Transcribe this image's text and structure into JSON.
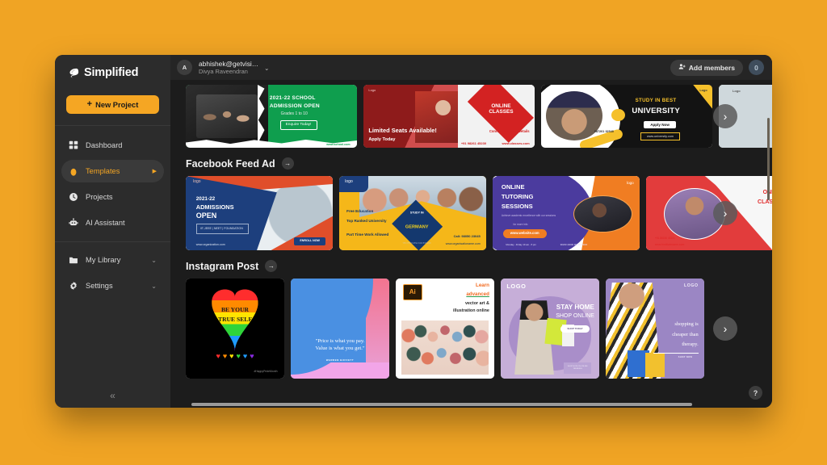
{
  "app": {
    "brand": "Simplified",
    "background_color": "#F0A424",
    "accent_color": "#F5A623",
    "window_bg": "#1c1c1c",
    "sidebar_bg": "#2c2c2c"
  },
  "sidebar": {
    "new_project_label": "New Project",
    "collapse_label": "«",
    "items": [
      {
        "label": "Dashboard",
        "icon": "grid-icon",
        "active": false,
        "caret": ""
      },
      {
        "label": "Templates",
        "icon": "templates-icon",
        "active": true,
        "caret": "right"
      },
      {
        "label": "Projects",
        "icon": "clock-icon",
        "active": false,
        "caret": ""
      },
      {
        "label": "AI Assistant",
        "icon": "robot-icon",
        "active": false,
        "caret": ""
      },
      {
        "label": "My Library",
        "icon": "folder-icon",
        "active": false,
        "caret": "down"
      },
      {
        "label": "Settings",
        "icon": "gear-icon",
        "active": false,
        "caret": "down"
      }
    ]
  },
  "topbar": {
    "avatar_initial": "A",
    "email": "abhishek@getvisi…",
    "name": "Divya Raveendran",
    "dropdown_icon": "chevron-down-icon",
    "add_members_label": "Add members",
    "add_members_icon": "add-user-icon",
    "member_count": "0"
  },
  "sections": [
    {
      "id": "banner-row",
      "title": "",
      "arrow_label": "→",
      "cards": [
        {
          "name": "school-admission-open-banner",
          "kind": "banner-green",
          "texts": {
            "line1": "2021-22 SCHOOL",
            "line2": "ADMISSION OPEN",
            "line3": "Grades 1 to 10",
            "cta": "Enquire Today!",
            "footer": "www.school.com"
          }
        },
        {
          "name": "online-classes-banner",
          "kind": "banner-red",
          "texts": {
            "logo": "Logo",
            "badge1": "ONLINE",
            "badge2": "CLASSES",
            "line1": "Limited Seats Available!",
            "line2": "Apply Today",
            "cta": "Connect for more Details",
            "phone": "+91 98261 45230",
            "url": "www.classes.com"
          }
        },
        {
          "name": "study-in-best-university-banner",
          "kind": "banner-dark",
          "texts": {
            "logo": "Logo",
            "line1": "STUDY IN BEST",
            "line2": "UNIVERSITY",
            "cta": "Apply Now",
            "url": "www.university.com",
            "phone": "987201 32540"
          }
        },
        {
          "name": "partial-banner",
          "kind": "banner-partial",
          "texts": {
            "logo": "Logo"
          }
        }
      ],
      "next_label": "›"
    },
    {
      "id": "facebook-feed-ad",
      "title": "Facebook Feed Ad",
      "arrow_label": "→",
      "cards": [
        {
          "name": "admissions-open-card",
          "kind": "fb-navy",
          "texts": {
            "logo": "logo",
            "line1": "2021-22",
            "line2": "ADMISSIONS",
            "line3": "OPEN",
            "tag": "IIT-JEEE | NEET | FOUNDATION",
            "url": "www.organization.com",
            "cta": "ENROLL NOW"
          }
        },
        {
          "name": "study-in-germany-card",
          "kind": "fb-yellow",
          "texts": {
            "logo": "logo",
            "b1": "Free Education",
            "b2": "Top Ranked University",
            "b3": "Part Time Work Allowed",
            "badge1": "STUDY IN",
            "badge2": "GERMANY",
            "badge3": "One of the leading study destination",
            "phone": "Call: 98050 23045",
            "url": "www.organisationame.com"
          }
        },
        {
          "name": "online-tutoring-sessions-card",
          "kind": "fb-purple",
          "texts": {
            "logo": "logo",
            "line1": "ONLINE",
            "line2": "TUTORING",
            "line3": "SESSIONS",
            "sub": "Achieve academic excellence with our sessions",
            "more": "for more info",
            "url": "www.website.com",
            "hours": "Monday - Friday 10 am - 5 pm",
            "phone": "90230 44000 90230 44000"
          }
        },
        {
          "name": "online-classes-partial-card",
          "kind": "fb-red",
          "texts": {
            "line1": "ONLINE",
            "line2": "CLASSES",
            "phone": "+91 86230 45101",
            "url": "www.institutename.com"
          }
        }
      ],
      "next_label": "›"
    },
    {
      "id": "instagram-post",
      "title": "Instagram Post",
      "arrow_label": "→",
      "cards": [
        {
          "name": "be-your-true-self-post",
          "kind": "ig-pride",
          "texts": {
            "line1": "BE YOUR",
            "line2": "TRUE SELF",
            "hashtag": "#HappyPrideMonth"
          }
        },
        {
          "name": "buffett-quote-post",
          "kind": "ig-quote",
          "texts": {
            "line1": "\"Price is what you pay.",
            "line2": "Value is what you get.\"",
            "author": "WARREN BUFFETT"
          }
        },
        {
          "name": "learn-vector-art-post",
          "kind": "ig-illustrator",
          "texts": {
            "badge": "Ai",
            "line1": "Learn",
            "line2": "advanced",
            "line3": "vector art &",
            "line4": "illustration online"
          }
        },
        {
          "name": "stay-home-shop-online-post",
          "kind": "ig-shop",
          "texts": {
            "logo": "LOGO",
            "line1": "STAY HOME",
            "line2": "SHOP ONLINE",
            "cta": "SHOP TODAY",
            "tag": "SHOP NOW ON ONLINE TRENDING"
          }
        },
        {
          "name": "shopping-cheaper-than-therapy-post",
          "kind": "ig-shopping",
          "texts": {
            "logo": "LOGO",
            "line1": "shopping is",
            "line2": "cheaper than",
            "line3": "therapy.",
            "cta": "SHOP NOW"
          }
        }
      ],
      "next_label": "›"
    }
  ],
  "help": {
    "label": "?"
  }
}
